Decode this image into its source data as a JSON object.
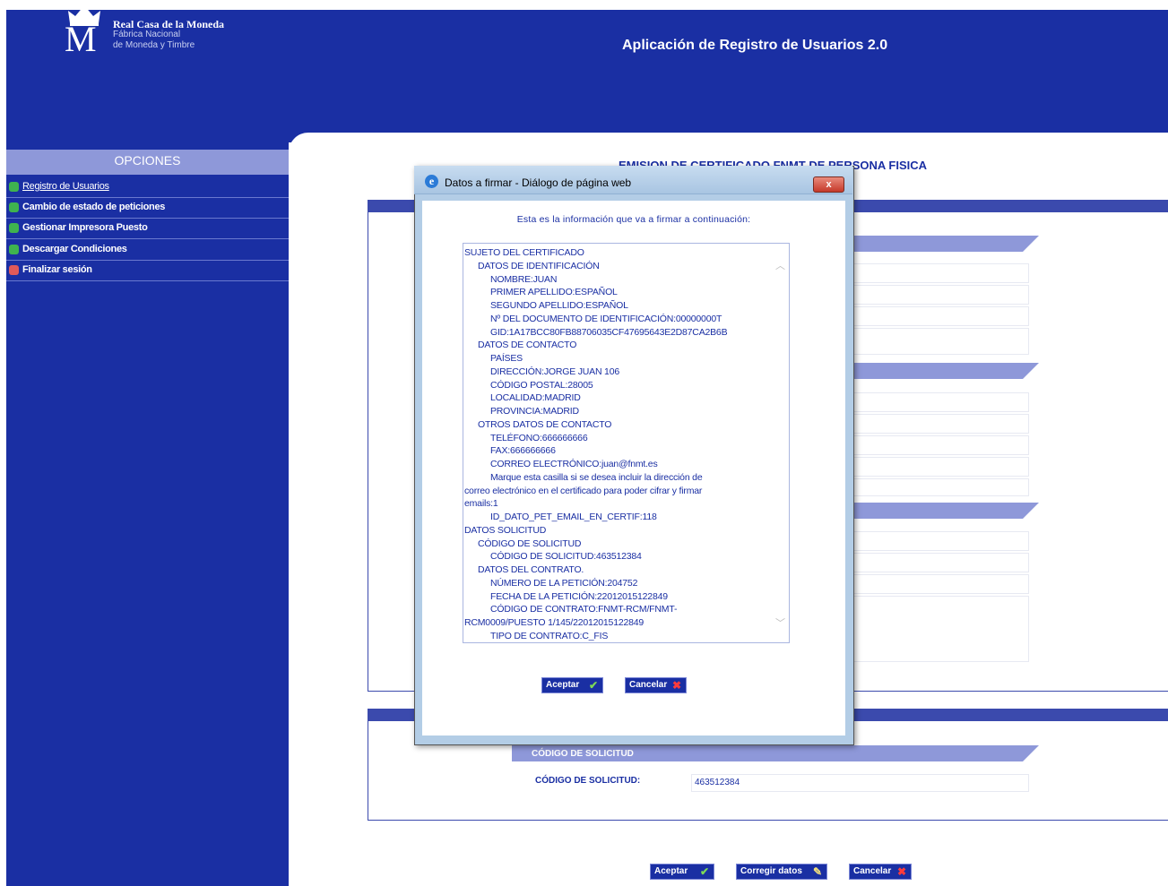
{
  "header": {
    "logo_name": "Real Casa de la Moneda",
    "logo_sub1": "Fábrica Nacional",
    "logo_sub2": "de Moneda y Timbre",
    "app_title": "Aplicación de Registro de Usuarios 2.0"
  },
  "sidebar": {
    "title": "OPCIONES",
    "items": [
      {
        "label": "Registro de Usuarios",
        "icon": "arrow-icon",
        "color": "#3fb34f"
      },
      {
        "label": "Cambio de estado de peticiones",
        "icon": "plus-icon",
        "color": "#3fb34f"
      },
      {
        "label": "Gestionar Impresora Puesto",
        "icon": "plus-icon",
        "color": "#3fb34f"
      },
      {
        "label": "Descargar Condiciones",
        "icon": "plus-icon",
        "color": "#3fb34f"
      },
      {
        "label": "Finalizar sesión",
        "icon": "exit-icon",
        "color": "#e05a5a"
      }
    ]
  },
  "main": {
    "form_title": "EMISION DE CERTIFICADO FNMT DE PERSONA FISICA",
    "codigo_section": "CÓDIGO DE SOLICITUD",
    "codigo_label": "CÓDIGO DE SOLICITUD:",
    "codigo_value": "463512384",
    "buttons": {
      "aceptar": "Aceptar",
      "corregir": "Corregir datos",
      "cancelar": "Cancelar"
    }
  },
  "dialog": {
    "title": "Datos a firmar - Diálogo de página web",
    "close_label": "x",
    "intro": "Esta es la información que va a firmar a continuación:",
    "lines": [
      {
        "indent": 0,
        "text": "SUJETO DEL CERTIFICADO"
      },
      {
        "indent": 1,
        "text": "DATOS DE IDENTIFICACIÓN"
      },
      {
        "indent": 2,
        "text": "NOMBRE:JUAN"
      },
      {
        "indent": 2,
        "text": "PRIMER APELLIDO:ESPAÑOL"
      },
      {
        "indent": 2,
        "text": "SEGUNDO APELLIDO:ESPAÑOL"
      },
      {
        "indent": 2,
        "text": "Nº DEL DOCUMENTO DE IDENTIFICACIÓN:00000000T"
      },
      {
        "indent": 2,
        "text": "GID:1A17BCC80FB88706035CF47695643E2D87CA2B6B"
      },
      {
        "indent": 1,
        "text": "DATOS DE CONTACTO"
      },
      {
        "indent": 2,
        "text": "PAÍSES"
      },
      {
        "indent": 2,
        "text": "DIRECCIÓN:JORGE JUAN 106"
      },
      {
        "indent": 2,
        "text": "CÓDIGO POSTAL:28005"
      },
      {
        "indent": 2,
        "text": "LOCALIDAD:MADRID"
      },
      {
        "indent": 2,
        "text": "PROVINCIA:MADRID"
      },
      {
        "indent": 1,
        "text": "OTROS DATOS DE CONTACTO"
      },
      {
        "indent": 2,
        "text": "TELÉFONO:666666666"
      },
      {
        "indent": 2,
        "text": "FAX:666666666"
      },
      {
        "indent": 2,
        "text": "CORREO ELECTRÓNICO:juan@fnmt.es"
      },
      {
        "indent": 2,
        "text": "Marque esta casilla si se desea incluir la dirección de"
      },
      {
        "indent": 0,
        "text": "correo electrónico en el certificado para poder cifrar y firmar"
      },
      {
        "indent": 0,
        "text": "emails:1"
      },
      {
        "indent": 2,
        "text": "ID_DATO_PET_EMAIL_EN_CERTIF:118"
      },
      {
        "indent": 0,
        "text": "DATOS SOLICITUD"
      },
      {
        "indent": 1,
        "text": "CÓDIGO DE SOLICITUD"
      },
      {
        "indent": 2,
        "text": "CÓDIGO DE SOLICITUD:463512384"
      },
      {
        "indent": 1,
        "text": "DATOS DEL CONTRATO."
      },
      {
        "indent": 2,
        "text": "NÚMERO DE LA PETICIÓN:204752"
      },
      {
        "indent": 2,
        "text": "FECHA DE LA PETICIÓN:22012015122849"
      },
      {
        "indent": 2,
        "text": "CÓDIGO DE CONTRATO:FNMT-RCM/FNMT-"
      },
      {
        "indent": 0,
        "text": "RCM0009/PUESTO 1/145/22012015122849"
      },
      {
        "indent": 2,
        "text": "TIPO DE CONTRATO:C_FIS"
      }
    ],
    "buttons": {
      "aceptar": "Aceptar",
      "cancelar": "Cancelar"
    }
  }
}
